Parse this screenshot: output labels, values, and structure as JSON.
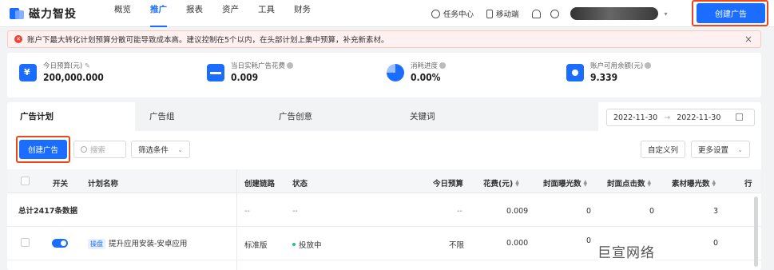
{
  "app": {
    "name": "磁力智投",
    "nav": [
      "概览",
      "推广",
      "报表",
      "资产",
      "工具",
      "财务"
    ],
    "active_nav": 1,
    "task_center": "任务中心",
    "mobile": "移动端",
    "create_ad": "创建广告"
  },
  "alert": {
    "message": "账户下最大转化计划预算分散可能导致成本高。建议控制在5个以内，在头部计划上集中预算，补充新素材。",
    "close": "×"
  },
  "stats": [
    {
      "label": "今日预算(元)",
      "value": "200,000.000"
    },
    {
      "label": "当日实耗广告花费",
      "value": "0.009"
    },
    {
      "label": "消耗进度",
      "value": "0.00%"
    },
    {
      "label": "账户可用余额(元)",
      "value": "9.339"
    }
  ],
  "tabs": [
    "广告计划",
    "广告组",
    "广告创意",
    "关键词"
  ],
  "active_tab": 0,
  "date_range": {
    "start": "2022-11-30",
    "arrow": "→",
    "end": "2022-11-30"
  },
  "toolbar": {
    "create": "创建广告",
    "search_placeholder": "搜索",
    "filter": "筛选条件",
    "custom_cols": "自定义列",
    "more_settings": "更多设置"
  },
  "table": {
    "headers": [
      "开关",
      "计划名称",
      "创建链路",
      "状态",
      "今日预算",
      "花费(元)",
      "封面曝光数",
      "封面点击数",
      "素材曝光数",
      "行"
    ],
    "total": {
      "label": "总计2417条数据",
      "link": "--",
      "status": "--",
      "budget": "--",
      "cost": "0.009",
      "cover_impr": "0",
      "cover_click": "0",
      "material_impr": "3"
    },
    "rows": [
      {
        "tag": "操盘",
        "name": "提升应用安装-安卓应用",
        "link": "标准版",
        "status": "投放中",
        "budget": "不限",
        "cost": "0.000",
        "cover_impr": "0",
        "cover_click": "",
        "material_impr": "0"
      }
    ]
  },
  "watermark": "巨宣网络",
  "colors": {
    "accent": "#1a6dff",
    "alert_red": "#f04134",
    "highlight_frame": "#e8481f",
    "status_green": "#1ec47d"
  }
}
